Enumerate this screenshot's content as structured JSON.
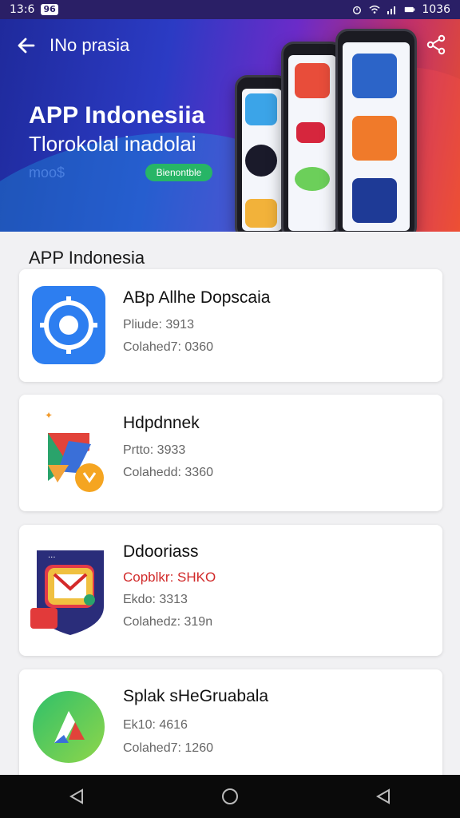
{
  "status_bar": {
    "time": "13:6",
    "badge": "96",
    "clock": "1036"
  },
  "topbar": {
    "title": "INo prasia"
  },
  "hero": {
    "title": "APP Indonesiia",
    "subtitle": "Tlorokolal inadolai",
    "tag": "moo$",
    "button": "Bienontble"
  },
  "section": {
    "title": "APP Indonesia"
  },
  "apps": [
    {
      "name": "ABp Allhe Dopscaia",
      "line1": "Pliude: 3913",
      "line2": "Colahed7: 0360"
    },
    {
      "name": "Hdpdnnek",
      "line1": "Prtto: 3933",
      "line2": "Colahedd: 3360"
    },
    {
      "name": "Ddooriass",
      "promo": "Copblkr: SHKO",
      "line1": "Ekdo: 3313",
      "line2": "Colahedz: 319n"
    },
    {
      "name": "Splak sHeGruabala",
      "line1": "Ek10: 4616",
      "line2": "Colahed7: 1260"
    }
  ],
  "icons": [
    "back-arrow-icon",
    "share-icon",
    "nav-back-icon",
    "nav-home-icon",
    "nav-recent-icon"
  ],
  "colors": {
    "hero_start": "#1f2a9c",
    "hero_end": "#e8502a",
    "accent_green": "#27b566",
    "promo_red": "#d12a2a"
  }
}
